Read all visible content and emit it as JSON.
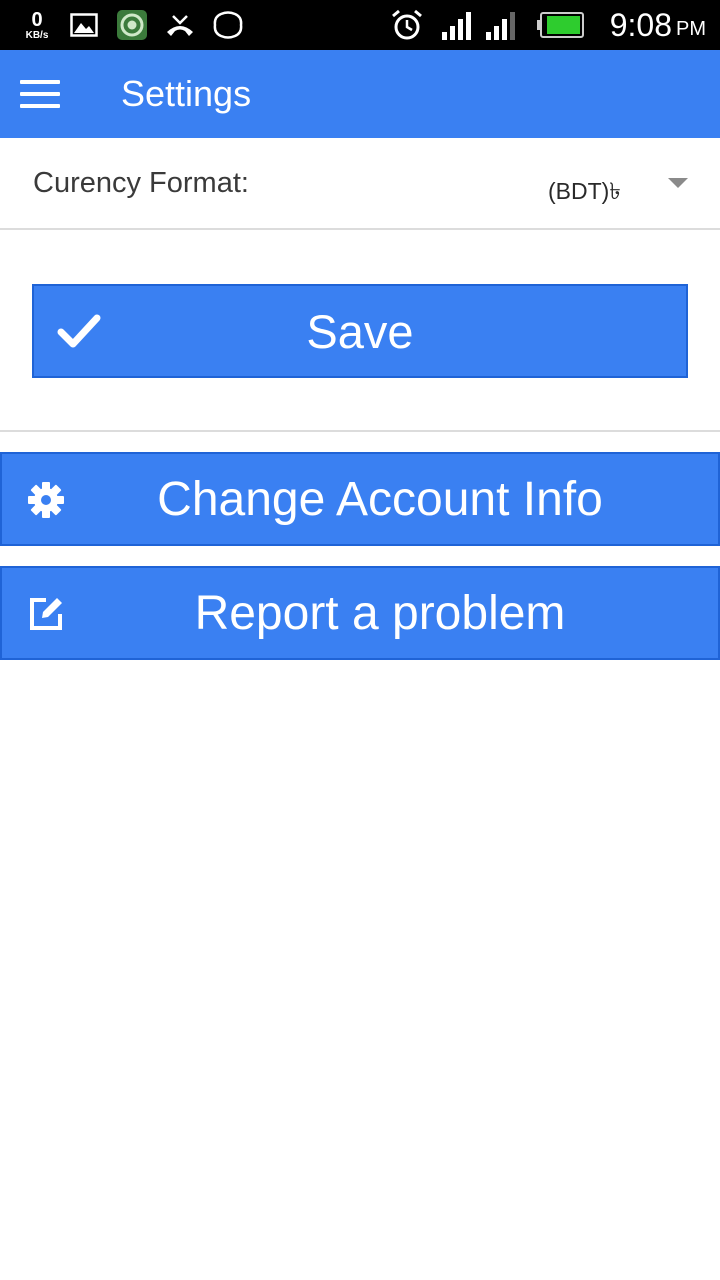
{
  "status_bar": {
    "net_speed_value": "0",
    "net_speed_unit": "KB/s",
    "time": "9:08",
    "ampm": "PM",
    "icons": [
      "gallery-icon",
      "app-icon",
      "missed-call-icon",
      "chat-icon",
      "alarm-icon",
      "signal-icon",
      "signal-icon",
      "battery-icon"
    ]
  },
  "app_bar": {
    "title": "Settings",
    "menu_icon": "menu-icon"
  },
  "settings": {
    "currency_label": "Curency Format:",
    "currency_value": "(BDT)৳"
  },
  "buttons": {
    "save_label": "Save",
    "change_account_label": "Change Account Info",
    "report_problem_label": "Report a problem"
  },
  "colors": {
    "primary": "#3a80f2",
    "primary_border": "#1f63d6",
    "status_bar": "#000000",
    "divider": "#dcdcdc"
  }
}
